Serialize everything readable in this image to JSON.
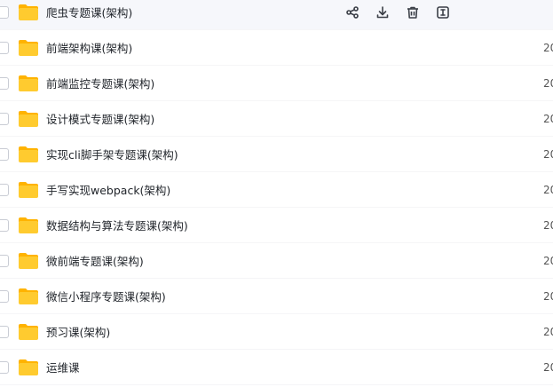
{
  "rows": [
    {
      "name": "爬虫专题课(架构)",
      "date": ""
    },
    {
      "name": "前端架构课(架构)",
      "date": "20"
    },
    {
      "name": "前端监控专题课(架构)",
      "date": "20"
    },
    {
      "name": "设计模式专题课(架构)",
      "date": "20"
    },
    {
      "name": "实现cli脚手架专题课(架构)",
      "date": "20"
    },
    {
      "name": "手写实现webpack(架构)",
      "date": "20"
    },
    {
      "name": "数据结构与算法专题课(架构)",
      "date": "20"
    },
    {
      "name": "微前端专题课(架构)",
      "date": "20"
    },
    {
      "name": "微信小程序专题课(架构)",
      "date": "20"
    },
    {
      "name": "预习课(架构)",
      "date": "20"
    },
    {
      "name": "运维课",
      "date": "20"
    }
  ],
  "hover_actions": [
    "share-icon",
    "download-icon",
    "delete-icon",
    "rename-icon"
  ],
  "colors": {
    "folder_body": "#FFCB2F",
    "folder_tab": "#FFB300",
    "hover_bg": "#f6f7fb",
    "icon": "#3b3f47"
  }
}
